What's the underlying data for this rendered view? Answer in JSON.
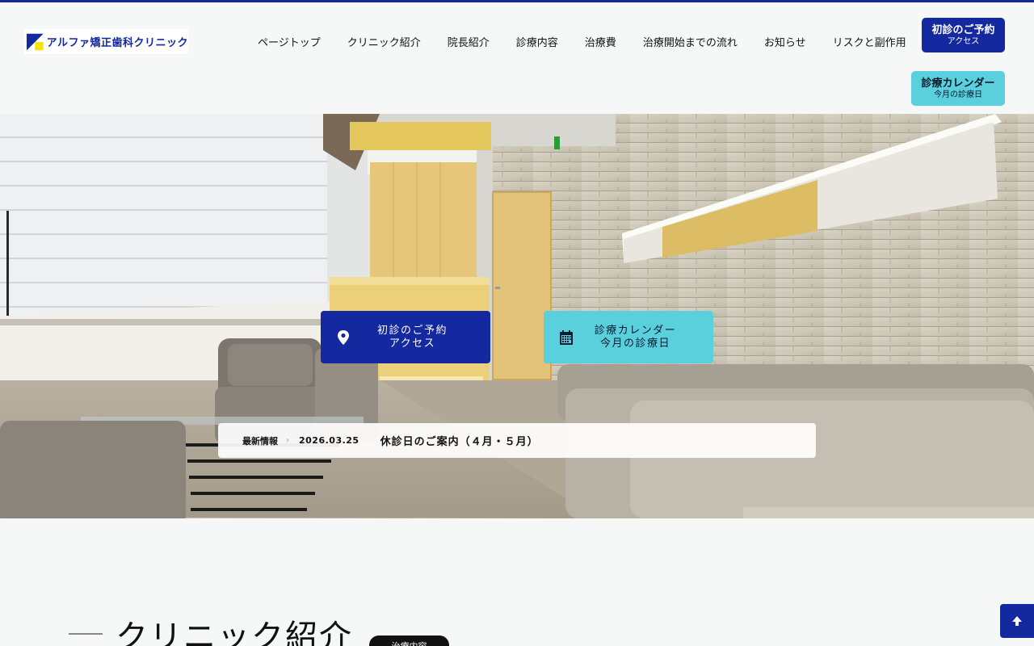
{
  "colors": {
    "primary": "#1428a0",
    "accent": "#5ad0dc",
    "background": "#f6f8f8"
  },
  "header": {
    "logo_text": "アルファ矯正歯科クリニック",
    "nav": [
      {
        "label": "ページトップ"
      },
      {
        "label": "クリニック紹介"
      },
      {
        "label": "院長紹介"
      },
      {
        "label": "診療内容"
      },
      {
        "label": "治療費"
      },
      {
        "label": "治療開始までの流れ"
      },
      {
        "label": "お知らせ"
      },
      {
        "label": "リスクと副作用"
      }
    ],
    "reserve_button": {
      "line1": "初診のご予約",
      "line2": "アクセス"
    },
    "calendar_button": {
      "line1": "診療カレンダー",
      "line2": "今月の診療日"
    }
  },
  "hero": {
    "cta_reserve": {
      "line1": "初診のご予約",
      "line2": "アクセス",
      "icon": "map-pin-icon"
    },
    "cta_calendar": {
      "line1": "診療カレンダー",
      "line2": "今月の診療日",
      "icon": "calendar-icon"
    },
    "news": {
      "label": "最新情報",
      "separator": "›",
      "date": "2026.03.25",
      "title": "休診日のご案内（４月・５月）"
    }
  },
  "section": {
    "title": "クリニック紹介",
    "tag": "治療内容"
  },
  "back_to_top": {
    "icon": "arrow-up-icon"
  }
}
